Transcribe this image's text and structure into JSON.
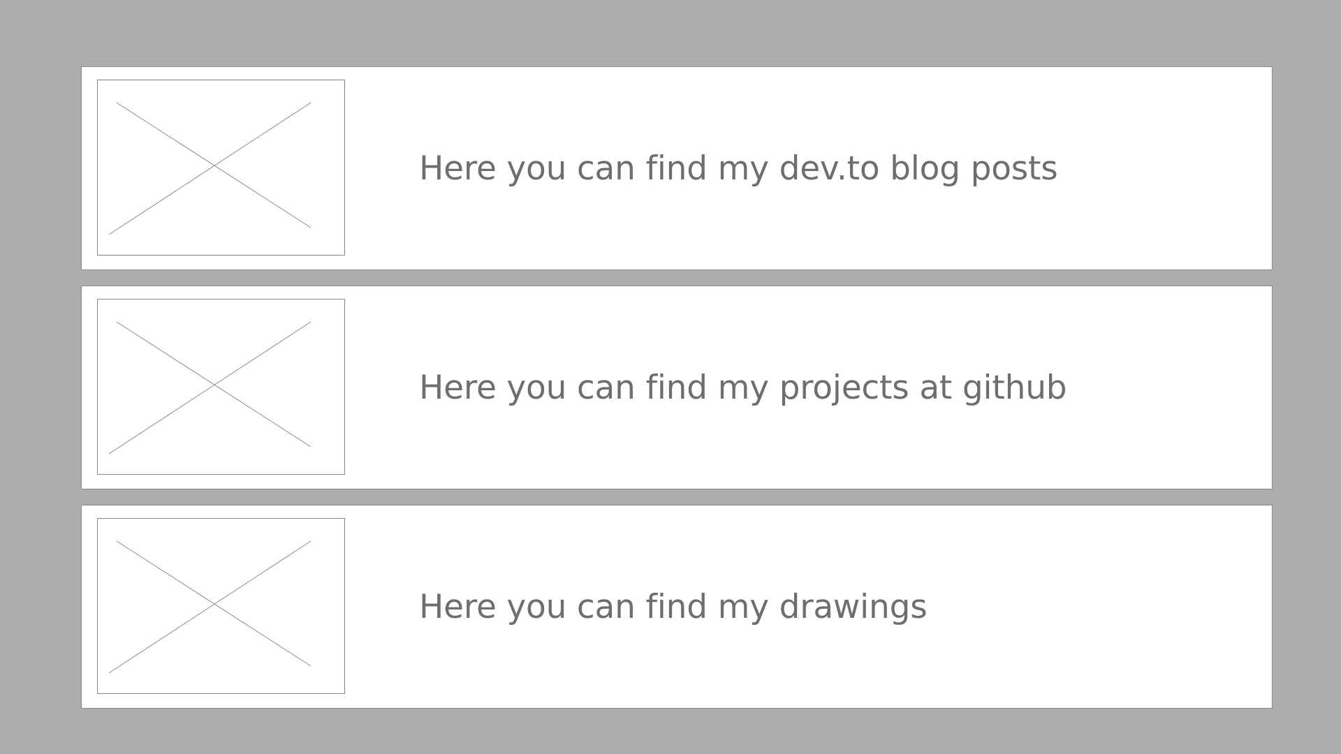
{
  "colors": {
    "background": "#adadad",
    "card_background": "#ffffff",
    "border": "#8a8a8a",
    "text": "#6e6e6e"
  },
  "cards": [
    {
      "label": "Here you can find my dev.to blog posts",
      "thumbnail_icon": "image-placeholder-icon"
    },
    {
      "label": "Here you can find my projects at github",
      "thumbnail_icon": "image-placeholder-icon"
    },
    {
      "label": "Here you can find my drawings",
      "thumbnail_icon": "image-placeholder-icon"
    }
  ]
}
